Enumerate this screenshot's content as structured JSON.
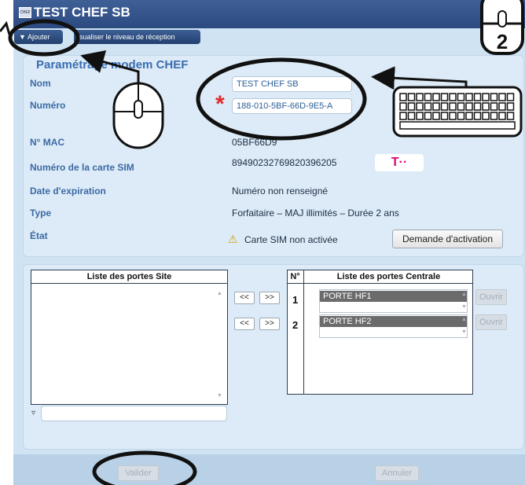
{
  "window": {
    "app_icon_text": "CHEF",
    "title": "TEST CHEF SB"
  },
  "toolbar": {
    "add_label": "Ajouter",
    "add_icon": "triangle-down-icon",
    "reception_label": "isualiser le niveau de réception"
  },
  "form": {
    "section_title": "Paramétrage modem CHEF",
    "fields": [
      {
        "label": "Nom",
        "value": "TEST CHEF SB"
      },
      {
        "label": "Numéro",
        "value": "188-010-5BF-66D-9E5-A"
      },
      {
        "label": "N° MAC",
        "value": "05BF66D9"
      },
      {
        "label": "Numéro de la carte SIM",
        "value": "89490232769820396205"
      },
      {
        "label": "Date d'expiration",
        "value": "Numéro non renseigné"
      },
      {
        "label": "Type",
        "value": "Forfaitaire – MAJ illimités – Durée 2 ans"
      },
      {
        "label": "État",
        "value": "Carte SIM non activée"
      }
    ],
    "required_mark": "*",
    "carrier_logo": "T··",
    "activation_button": "Demande d'activation",
    "warning_icon": "warning-triangle-icon"
  },
  "ports": {
    "site_header": "Liste des portes Site",
    "filter_icon": "filter-icon",
    "filter_value": "",
    "move_left_label": "<<",
    "move_right_label": ">>",
    "num_header": "N°",
    "central_header": "Liste des portes Centrale",
    "rows": [
      {
        "num": "1",
        "name": "PORTE HF1",
        "open_label": "Ouvrir"
      },
      {
        "num": "2",
        "name": "PORTE HF2",
        "open_label": "Ouvrir"
      }
    ]
  },
  "footer": {
    "validate_label": "Valider",
    "cancel_label": "Annuler"
  },
  "annotations": {
    "step_number": "2",
    "mouse_icon": "mouse-icon",
    "keyboard_icon": "keyboard-icon"
  },
  "colors": {
    "titlebar": "#2f4f86",
    "panel": "#dcebf7",
    "label": "#3c6aa4",
    "annotation": "#111111",
    "required": "#e02b2b"
  }
}
